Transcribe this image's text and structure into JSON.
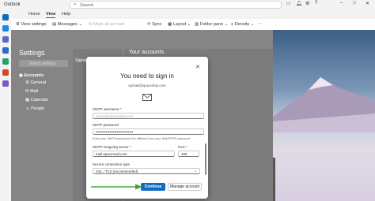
{
  "app": {
    "title": "Outlook"
  },
  "search": {
    "placeholder": "Search"
  },
  "tabs": [
    "Home",
    "View",
    "Help"
  ],
  "ribbon": [
    "View settings",
    "Messages",
    "Mark all as read",
    "Sync",
    "Layout",
    "Folder pane",
    "Density"
  ],
  "settings": {
    "title": "Settings",
    "search_placeholder": "Search settings",
    "nav": [
      "Accounts",
      "General",
      "Mail",
      "Calendar",
      "People"
    ],
    "panel_item": "Signat",
    "content_title": "Your accounts"
  },
  "dialog": {
    "title": "You need to sign in",
    "email": "sprisel@spaceship.com",
    "smtp_username_label": "SMTP username *",
    "smtp_username_value": "sprisel@spaceship.com",
    "smtp_password_label": "SMTP password",
    "smtp_password_value": "••••••••••••••••••••••••••••••",
    "password_hint": "Enter your SMTP password if it's different from your IMAP/POP password",
    "server_label": "SMTP Outgoing server *",
    "server_value": "mail.spacemail.com",
    "port_label": "Port *",
    "port_value": "465",
    "security_label": "Secure connection type",
    "security_value": "SSL / TLS (recommended)",
    "continue_label": "Continue",
    "manage_label": "Manage account"
  },
  "colors": {
    "accent": "#0f6cbd",
    "arrow": "#3aa63a"
  }
}
